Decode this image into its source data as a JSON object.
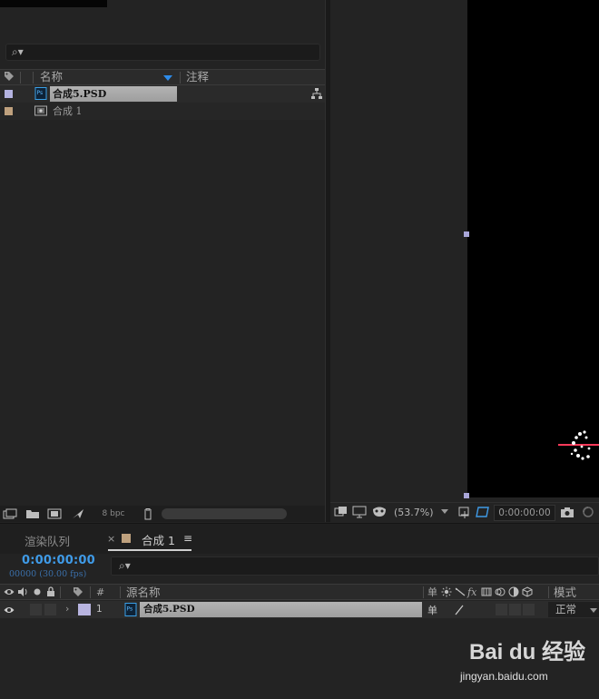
{
  "project": {
    "columns": {
      "name": "名称",
      "comment": "注释"
    },
    "items": [
      {
        "name": "合成5.PSD",
        "swatch": "#b4b3e0",
        "icon": "psd-file-icon"
      },
      {
        "name": "合成 1",
        "swatch": "#bfa17e",
        "icon": "composition-icon"
      }
    ],
    "footer": {
      "bpc": "8 bpc"
    }
  },
  "viewer": {
    "zoom": "(53.7%)",
    "time": "0:00:00:00"
  },
  "timeline": {
    "tabs": {
      "render_queue": "渲染队列",
      "comp": "合成 1",
      "comp_swatch": "#bfa17e"
    },
    "timecode": "0:00:00:00",
    "frames": "00000 (30.00 fps)",
    "columns": {
      "hash": "#",
      "source_name": "源名称",
      "mode": "模式",
      "parent_glyph": "单"
    },
    "layer": {
      "number": "1",
      "name": "合成5.PSD",
      "mode": "正常",
      "parent_glyph": "单"
    }
  },
  "watermark": {
    "brand": "Bai du 经验",
    "url": "jingyan.baidu.com"
  },
  "colors": {
    "accent": "#2d8ceb",
    "timecode": "#3f9be8",
    "psd_label": "#b8b4e0",
    "comp_label": "#bfa17e"
  }
}
